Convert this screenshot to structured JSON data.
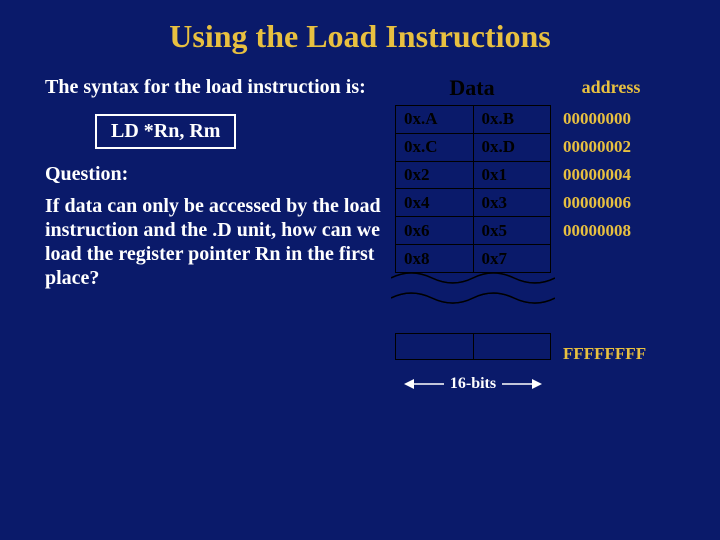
{
  "title": "Using the Load Instructions",
  "left": {
    "syntax_text": "The syntax for the load instruction is:",
    "instruction": "LD   *Rn, Rm",
    "question_label": "Question:",
    "question_body": "If data can only be accessed by the load instruction and the .D unit, how can we load the register pointer Rn in the first place?"
  },
  "table": {
    "data_header": "Data",
    "addr_header": "address",
    "rows": [
      {
        "c0": "0x.A",
        "c1": "0x.B",
        "addr": "00000000"
      },
      {
        "c0": "0x.C",
        "c1": "0x.D",
        "addr": "00000002"
      },
      {
        "c0": "0x2",
        "c1": "0x1",
        "addr": "00000004"
      },
      {
        "c0": "0x4",
        "c1": "0x3",
        "addr": "00000006"
      },
      {
        "c0": "0x6",
        "c1": "0x5",
        "addr": "00000008"
      },
      {
        "c0": "0x8",
        "c1": "0x7",
        "addr": ""
      }
    ],
    "end_addr": "FFFFFFFF",
    "width_label": "16-bits"
  }
}
